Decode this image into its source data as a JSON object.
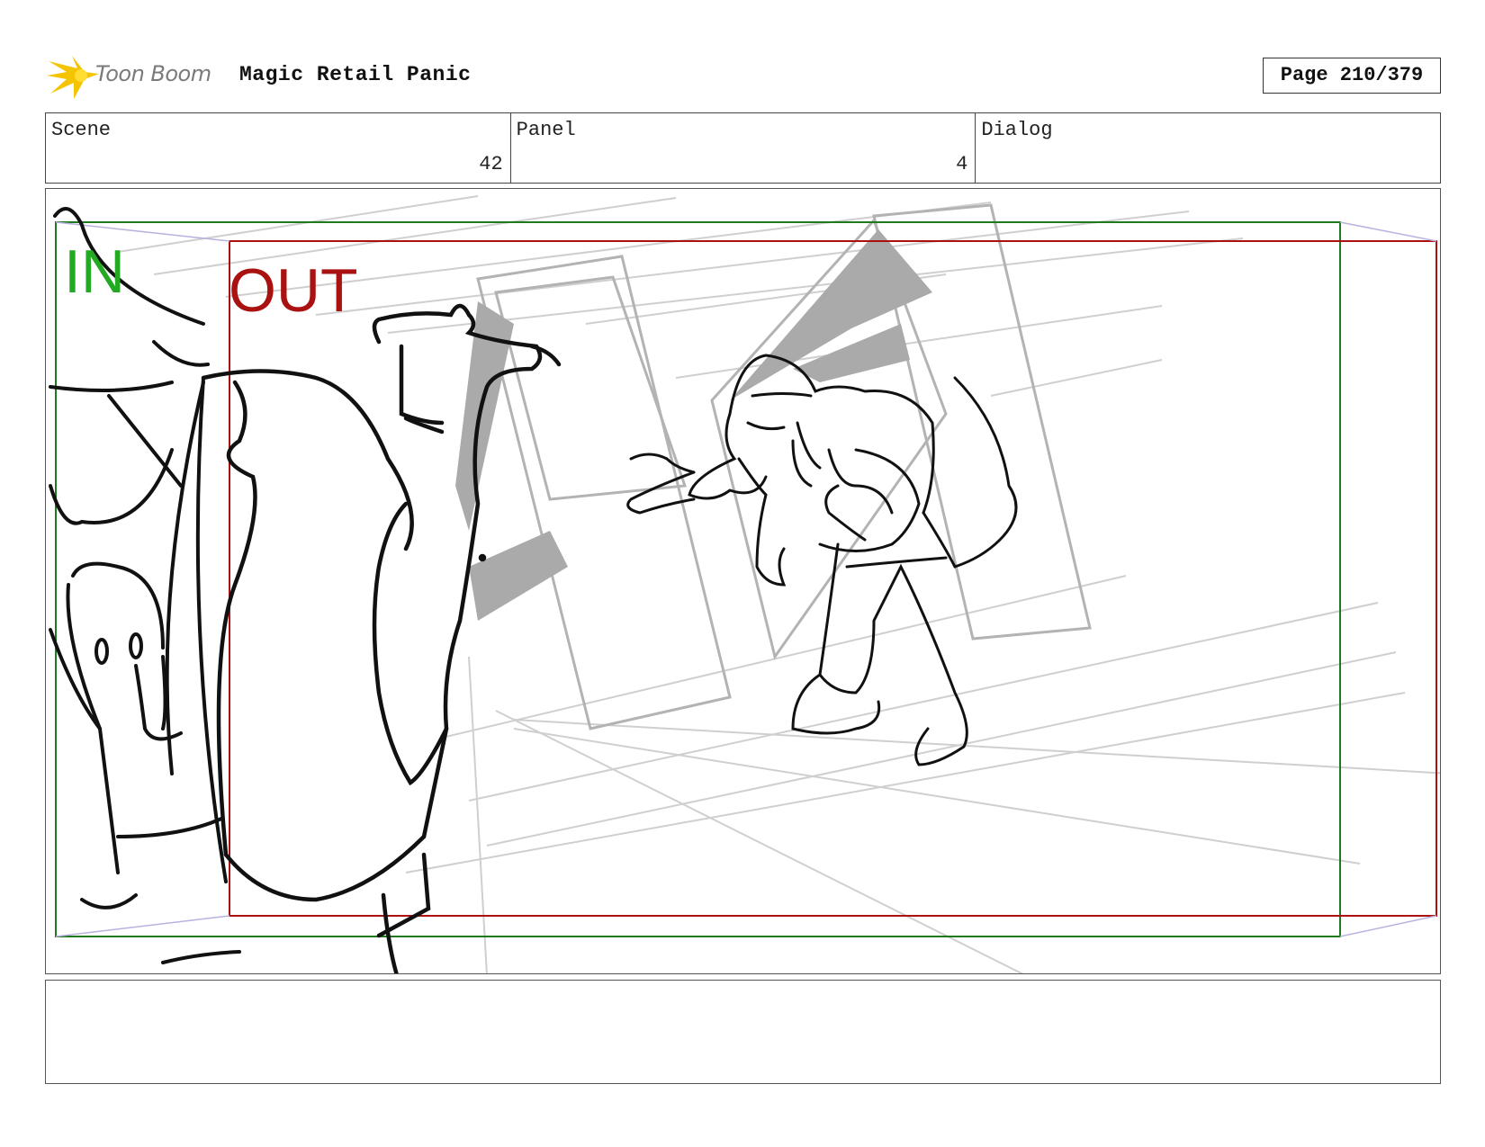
{
  "header": {
    "logo_text": "Toon Boom",
    "project_title": "Magic Retail Panic",
    "page_label": "Page 210/379"
  },
  "info": {
    "scene_label": "Scene",
    "scene_value": "42",
    "panel_label": "Panel",
    "panel_value": "4",
    "dialog_label": "Dialog",
    "dialog_value": ""
  },
  "frame_labels": {
    "in": "IN",
    "out": "OUT"
  },
  "colors": {
    "in_frame": "#1f7a1f",
    "in_text": "#22aa22",
    "out_frame": "#aa1111",
    "out_text": "#aa1111",
    "perspective_guide": "#b8b2e0",
    "logo_star": "#f5c400"
  },
  "notes": ""
}
